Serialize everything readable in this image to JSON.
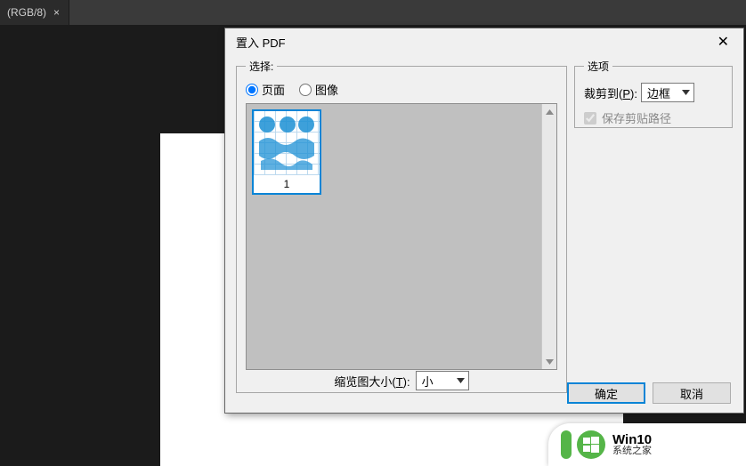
{
  "tab": {
    "label": "(RGB/8)",
    "close_glyph": "×"
  },
  "dialog": {
    "title": "置入 PDF",
    "close_glyph": "✕",
    "select": {
      "legend": "选择:",
      "radio_page": "页面",
      "radio_image": "图像",
      "thumb_page_number": "1",
      "thumbsize_label_prefix": "缩览图大小(",
      "thumbsize_hotkey": "T",
      "thumbsize_label_suffix": "):",
      "thumbsize_value": "小"
    },
    "options": {
      "legend": "选项",
      "crop_label_prefix": "裁剪到(",
      "crop_hotkey": "P",
      "crop_label_suffix": "):",
      "crop_value": "边框",
      "preserve_clip": "保存剪贴路径"
    },
    "buttons": {
      "ok": "确定",
      "cancel": "取消"
    }
  },
  "watermark": {
    "line1": "Win10",
    "line2": "系统之家"
  }
}
